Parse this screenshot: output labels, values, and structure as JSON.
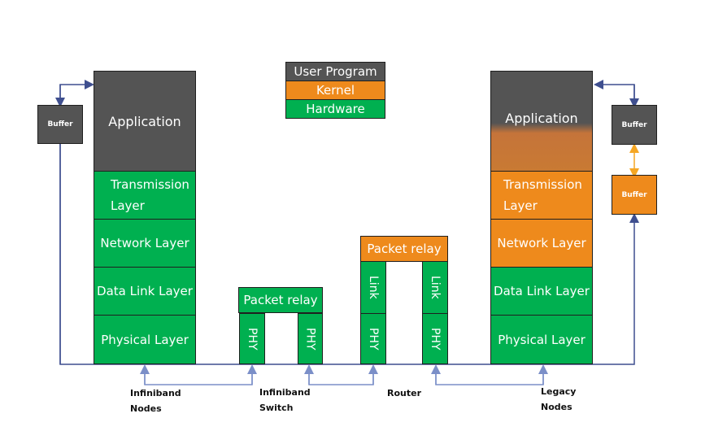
{
  "legend": {
    "items": [
      {
        "label": "User Program",
        "color": "#545454"
      },
      {
        "label": "Kernel",
        "color": "#ee8a1c"
      },
      {
        "label": "Hardware",
        "color": "#00b050"
      }
    ]
  },
  "left_stack": {
    "caption_line1": "Infiniband",
    "caption_line2": "Nodes",
    "buffer": "Buffer",
    "layers": {
      "application": "Application",
      "transmission_1": "Transmission",
      "transmission_2": "Layer",
      "network": "Network Layer",
      "datalink": "Data Link Layer",
      "physical": "Physical Layer"
    }
  },
  "switch": {
    "caption_line1": "Infiniband",
    "caption_line2": "Switch",
    "relay": "Packet relay",
    "phy": "PHY"
  },
  "router": {
    "caption": "Router",
    "relay": "Packet relay",
    "link": "Link",
    "phy": "PHY"
  },
  "right_stack": {
    "caption_line1": "Legacy",
    "caption_line2": "Nodes",
    "buffer_user": "Buffer",
    "buffer_kernel": "Buffer",
    "layers": {
      "application": "Application",
      "transmission_1": "Transmission",
      "transmission_2": "Layer",
      "network": "Network Layer",
      "datalink": "Data Link Layer",
      "physical": "Physical Layer"
    }
  },
  "colors": {
    "arrow": "#3f4f8f",
    "arrow_light": "#7b8fc8",
    "arrow_orange": "#f5a623"
  }
}
